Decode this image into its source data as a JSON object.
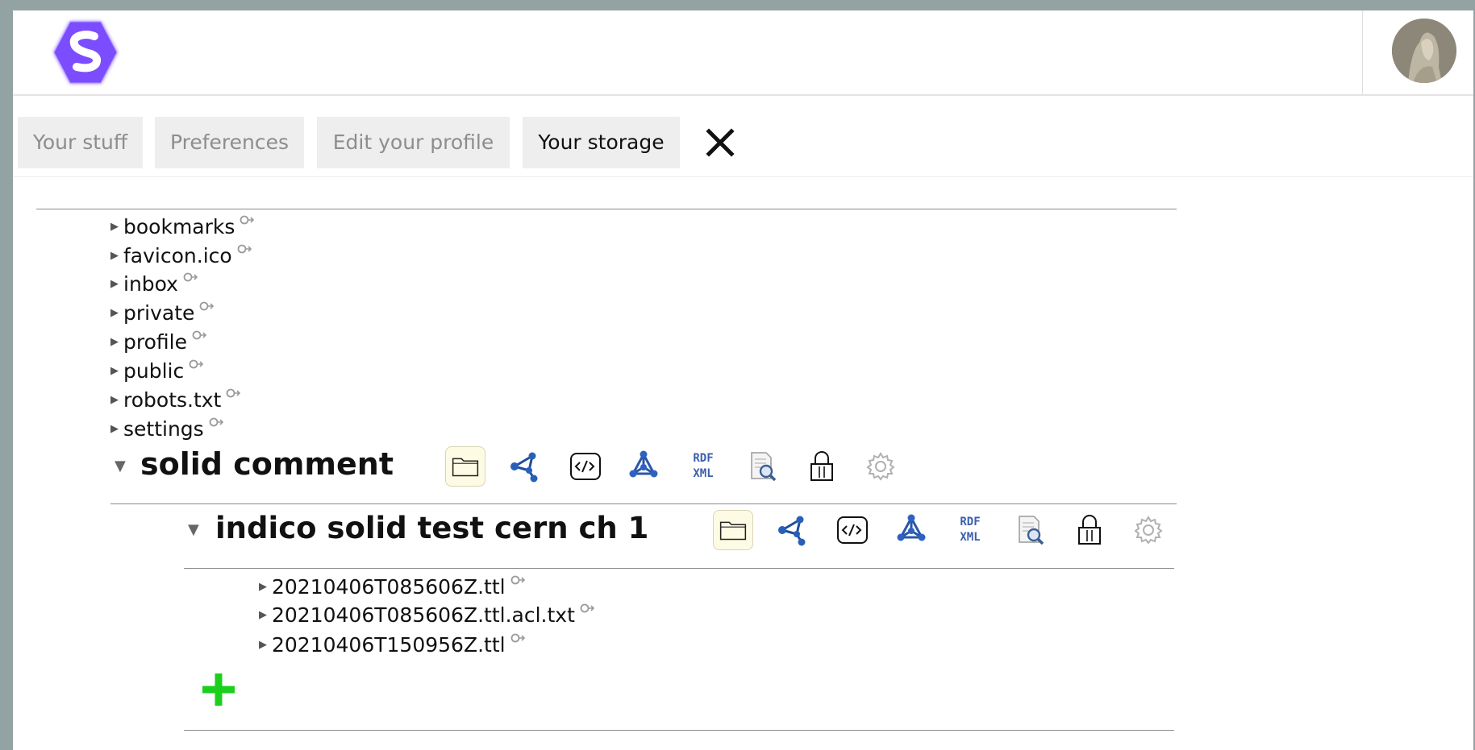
{
  "app": {
    "logo_icon": "solid-logo-icon",
    "avatar_icon": "user-avatar-image",
    "accent_color": "#7c4dff"
  },
  "tabs": [
    {
      "label": "Your stuff",
      "active": false
    },
    {
      "label": "Preferences",
      "active": false
    },
    {
      "label": "Edit your profile",
      "active": false
    },
    {
      "label": "Your storage",
      "active": true
    }
  ],
  "close_icon": "close-icon",
  "root_items": [
    {
      "name": "bookmarks"
    },
    {
      "name": "favicon.ico"
    },
    {
      "name": "inbox"
    },
    {
      "name": "private"
    },
    {
      "name": "profile"
    },
    {
      "name": "public"
    },
    {
      "name": "robots.txt"
    },
    {
      "name": "settings"
    }
  ],
  "folder": {
    "title": "solid comment",
    "toolbar": [
      "folder-icon",
      "graph-icon",
      "source-code-icon",
      "rdf-graph-icon",
      "rdf-xml-icon",
      "document-search-icon",
      "lock-icon",
      "settings-gear-icon"
    ],
    "subfolder": {
      "title": "indico solid test cern ch 1",
      "toolbar": [
        "folder-icon",
        "graph-icon",
        "source-code-icon",
        "rdf-graph-icon",
        "rdf-xml-icon",
        "document-search-icon",
        "lock-icon",
        "settings-gear-icon"
      ],
      "items": [
        {
          "name": "20210406T085606Z.ttl"
        },
        {
          "name": "20210406T085606Z.ttl.acl.txt"
        },
        {
          "name": "20210406T150956Z.ttl"
        }
      ]
    }
  },
  "add_icon": "add-plus-icon",
  "rdf_xml_text": [
    "RDF",
    "XML"
  ]
}
